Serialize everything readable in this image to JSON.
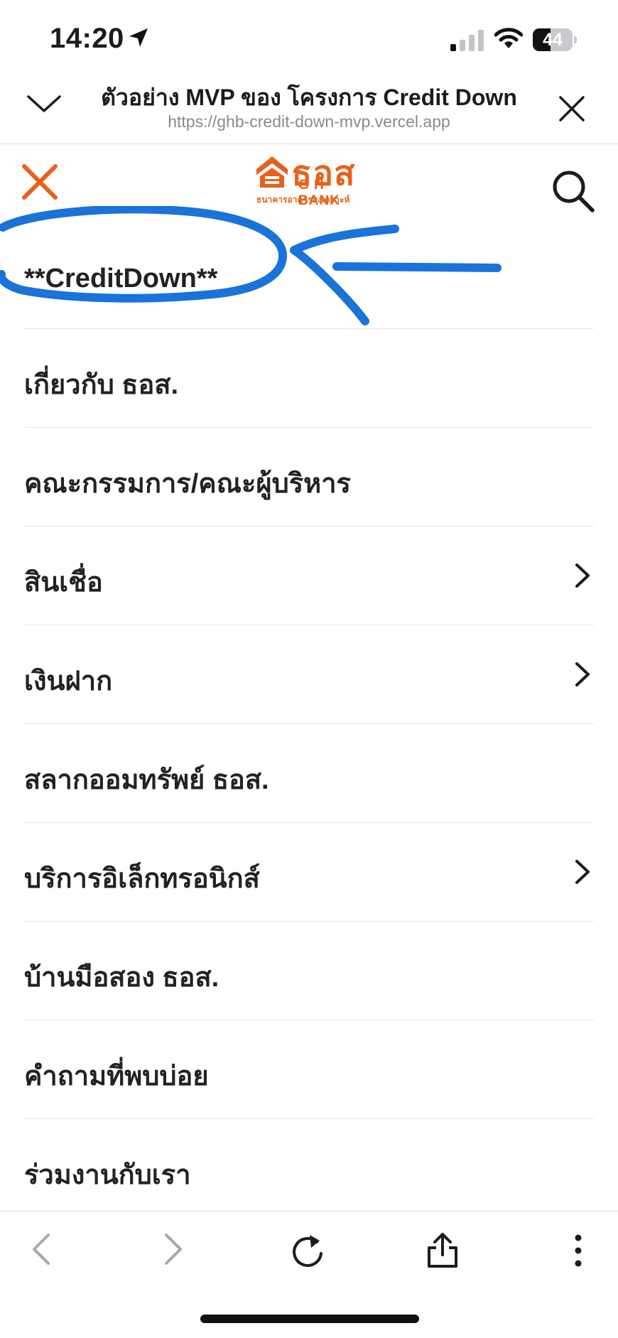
{
  "status_bar": {
    "time": "14:20",
    "battery_level": "44",
    "battery_fraction": 0.44
  },
  "browser": {
    "title": "ตัวอย่าง MVP ของ โครงการ Credit Down",
    "url": "https://ghb-credit-down-mvp.vercel.app"
  },
  "site": {
    "logo_thai": "ธอส",
    "logo_bank": "G H BANK",
    "logo_sub": "ธนาคารอาคารสงเคราะห์",
    "accent_color": "#e8611a"
  },
  "menu": {
    "items": [
      {
        "label": "**CreditDown**",
        "has_submenu": false
      },
      {
        "label": "เกี่ยวกับ ธอส.",
        "has_submenu": false
      },
      {
        "label": "คณะกรรมการ/คณะผู้บริหาร",
        "has_submenu": false
      },
      {
        "label": "สินเชื่อ",
        "has_submenu": true
      },
      {
        "label": "เงินฝาก",
        "has_submenu": true
      },
      {
        "label": "สลากออมทรัพย์ ธอส.",
        "has_submenu": false
      },
      {
        "label": "บริการอิเล็กทรอนิกส์",
        "has_submenu": true
      },
      {
        "label": "บ้านมือสอง ธอส.",
        "has_submenu": false
      },
      {
        "label": "คำถามที่พบบ่อย",
        "has_submenu": false
      },
      {
        "label": "ร่วมงานกับเรา",
        "has_submenu": false
      }
    ]
  },
  "annotation": {
    "color": "#1a73d9",
    "shapes": [
      "ellipse",
      "arrow"
    ]
  },
  "toolbar": {
    "icons": [
      "back-icon",
      "forward-icon",
      "reload-icon",
      "share-icon",
      "more-icon"
    ]
  }
}
